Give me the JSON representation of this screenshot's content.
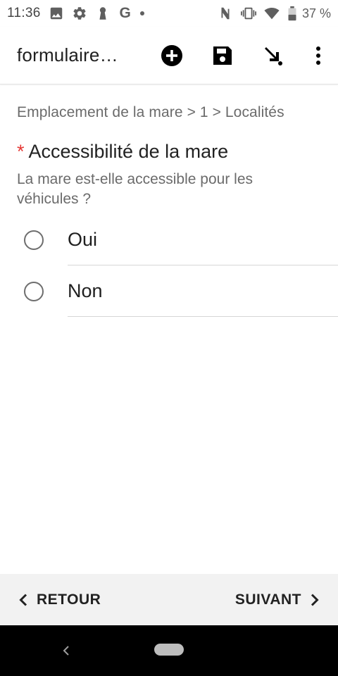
{
  "status_bar": {
    "time": "11:36",
    "left_icons": [
      "image-icon",
      "gear-icon",
      "keyhole-icon",
      "google-icon",
      "dot-icon"
    ],
    "google_letter": "G",
    "right_icons": [
      "nfc-icon",
      "vibrate-icon",
      "wifi-icon",
      "battery-icon"
    ],
    "battery": "37 %"
  },
  "app_bar": {
    "title": "formulaire…",
    "actions": [
      "add-icon",
      "save-icon",
      "finalize-icon",
      "more-vert-icon"
    ]
  },
  "breadcrumb": "Emplacement de la mare > 1 > Localités",
  "question": {
    "required_marker": "*",
    "title": "Accessibilité de la mare",
    "hint": "La mare est-elle accessible pour les véhicules ?",
    "options": [
      {
        "label": "Oui"
      },
      {
        "label": "Non"
      }
    ]
  },
  "bottom_nav": {
    "back_label": "RETOUR",
    "next_label": "SUIVANT"
  },
  "colors": {
    "required": "#e53935",
    "nav_background": "#f2f2f2",
    "system_bar": "#000000"
  }
}
